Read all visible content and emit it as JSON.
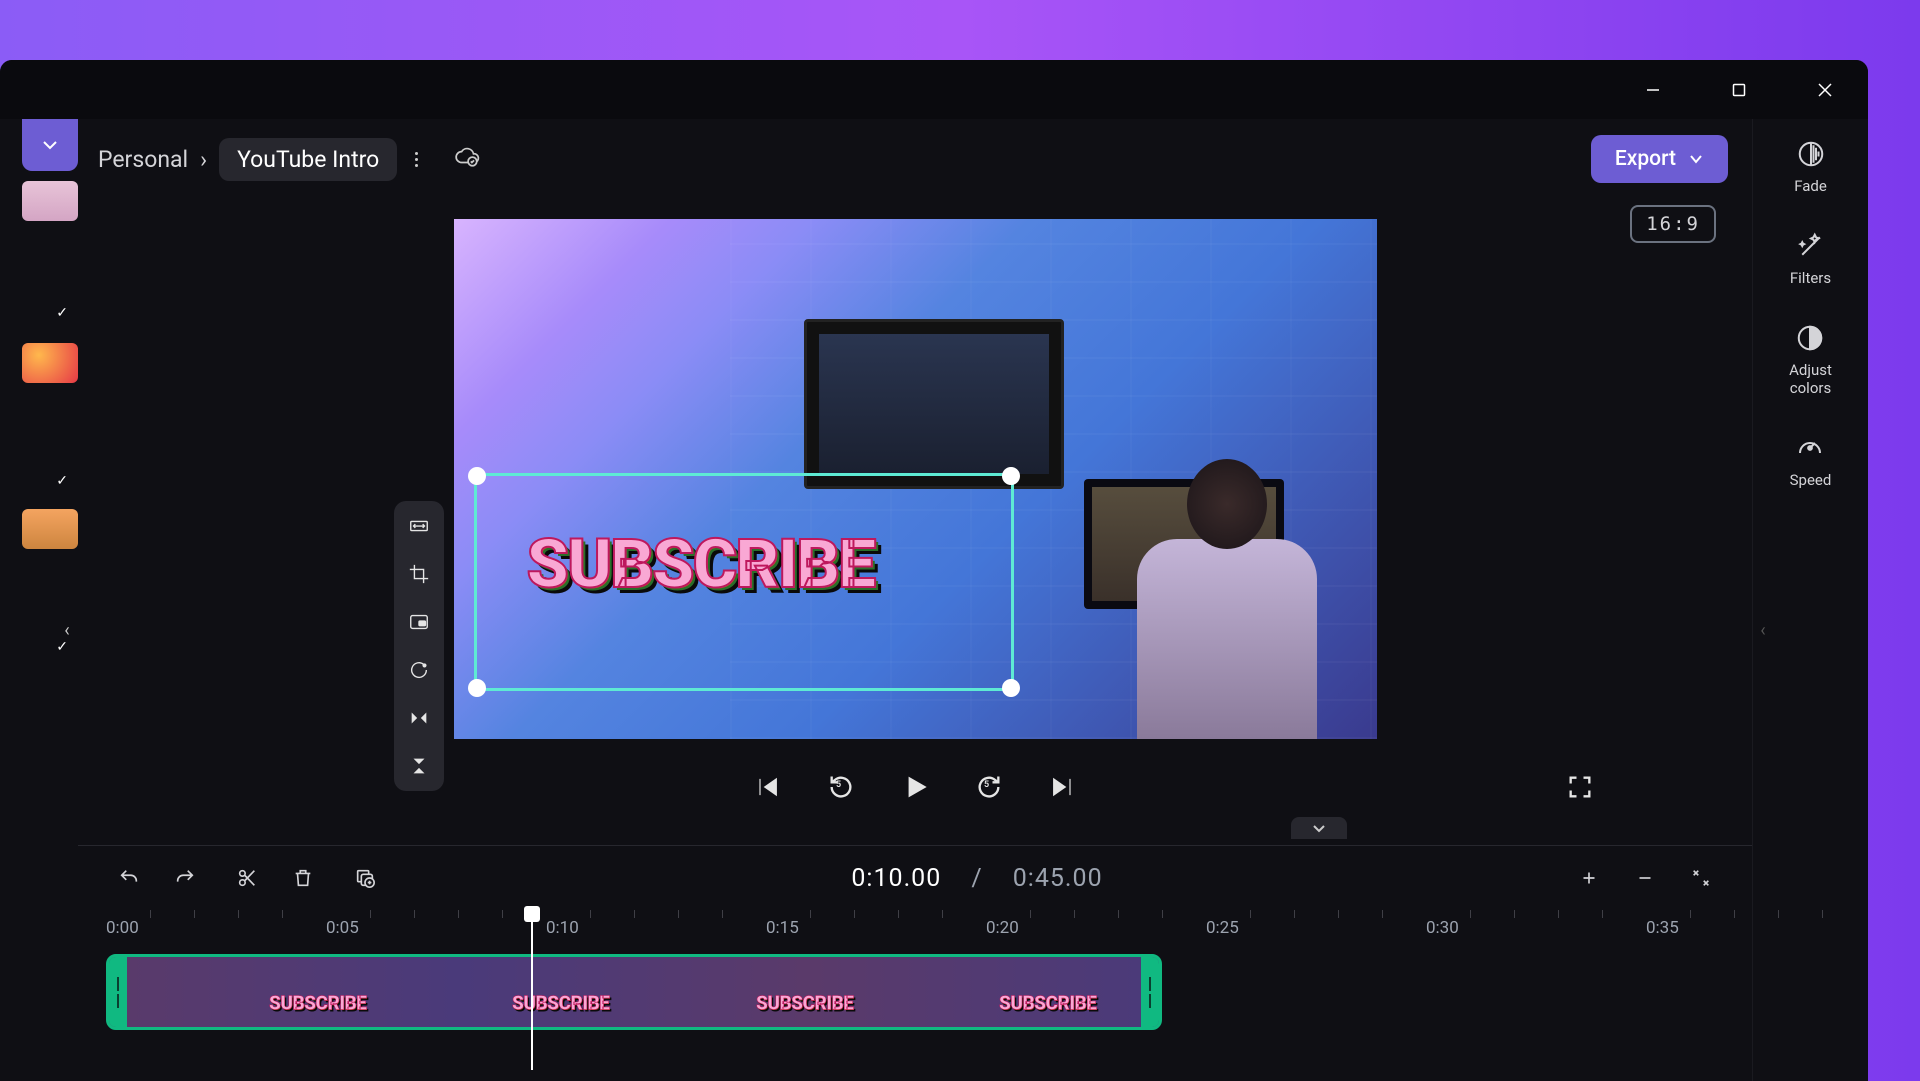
{
  "header": {
    "breadcrumb_root": "Personal",
    "project_name": "YouTube Intro",
    "export_label": "Export"
  },
  "preview": {
    "aspect_ratio": "16:9",
    "sticker_text": "SUBSCRIBE"
  },
  "element_toolbar": {
    "items": [
      "fit",
      "crop",
      "pip",
      "rotate",
      "flip-h",
      "flip-v"
    ]
  },
  "playback": {
    "rewind_seconds": "5",
    "forward_seconds": "5"
  },
  "timeline": {
    "current_time": "0:10.00",
    "duration": "0:45.00",
    "ruler": [
      "0:00",
      "0:05",
      "0:10",
      "0:15",
      "0:20",
      "0:25",
      "0:30",
      "0:35"
    ]
  },
  "right_bar": {
    "fade": "Fade",
    "filters": "Filters",
    "adjust_colors": "Adjust\ncolors",
    "speed": "Speed"
  },
  "colors": {
    "accent": "#6d5dd3",
    "selection": "#5eead4",
    "clip_border": "#10b981"
  }
}
